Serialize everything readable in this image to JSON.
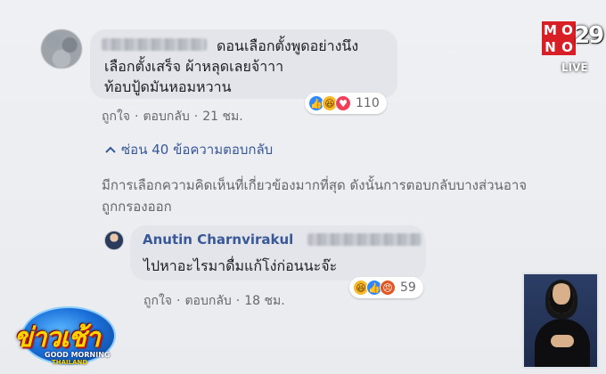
{
  "comment1": {
    "text_line1": "ดอนเลือกตั้งพูดอย่างนึง",
    "text_line2": "เลือกตั้งเสร็จ ผ้าหลุดเลยจ้าาา",
    "text_line3": "ท้อบปู้ดมันหอมหวาน",
    "reaction_count": "110",
    "like_label": "ถูกใจ",
    "reply_label": "ตอบกลับ",
    "time": "21 ชม."
  },
  "replies_toggle": {
    "label": "ซ่อน 40 ข้อความตอบกลับ"
  },
  "notice": {
    "text": "มีการเลือกความคิดเห็นที่เกี่ยวข้องมากที่สุด ดังนั้นการตอบกลับบางส่วนอาจถูกกรองออก"
  },
  "reply1": {
    "author": "Anutin Charnvirakul",
    "text": "ไปหาอะไรมาดื่มแก้โง่ก่อนนะจ๊ะ",
    "reaction_count": "59",
    "like_label": "ถูกใจ",
    "reply_label": "ตอบกลับ",
    "time": "18 ชม."
  },
  "channel": {
    "brand": "MONO",
    "number": "29",
    "live": "LIVE"
  },
  "show": {
    "title": "ข่าวเช้า",
    "subtitle": "GOOD MORNING",
    "subtitle2": "THAILAND"
  },
  "colors": {
    "link": "#385898",
    "bubble": "#e3e5ea",
    "meta_text": "#65676b",
    "like": "#2d88ff",
    "haha": "#f7b928",
    "angry": "#e4561f",
    "love": "#f33e58",
    "channel_red": "#d91f26"
  },
  "icons": {
    "chevron": "chevron-up-icon",
    "like": "like-reaction-icon",
    "haha": "haha-reaction-icon",
    "love": "love-reaction-icon",
    "angry": "angry-reaction-icon"
  }
}
